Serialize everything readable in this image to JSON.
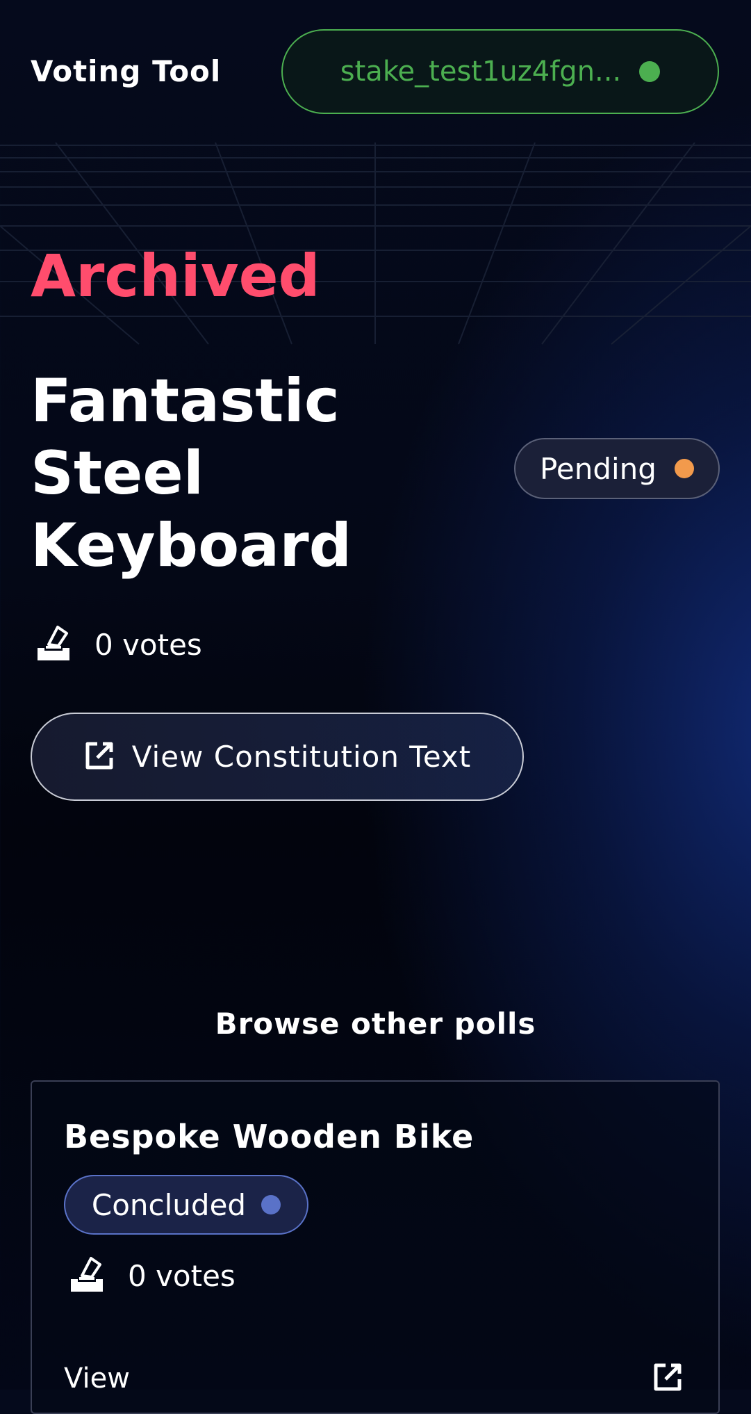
{
  "header": {
    "brand": "Voting Tool",
    "wallet_label": "stake_test1uz4fgn...",
    "wallet_status_color": "#4caf50"
  },
  "poll": {
    "section_label": "Archived",
    "title": "Fantastic Steel Keyboard",
    "status": "Pending",
    "status_color": "#f29a4c",
    "votes": "0 votes",
    "constitution_button": "View Constitution Text"
  },
  "browse": {
    "heading": "Browse other polls",
    "cards": [
      {
        "title": "Bespoke Wooden Bike",
        "status": "Concluded",
        "status_color": "#5a72c8",
        "votes": "0 votes",
        "view_label": "View"
      }
    ]
  },
  "colors": {
    "accent_pink": "#ff4d6d",
    "wallet_green": "#4caf50"
  },
  "icons": {
    "votes": "ballot-box-icon",
    "external": "external-link-icon"
  }
}
